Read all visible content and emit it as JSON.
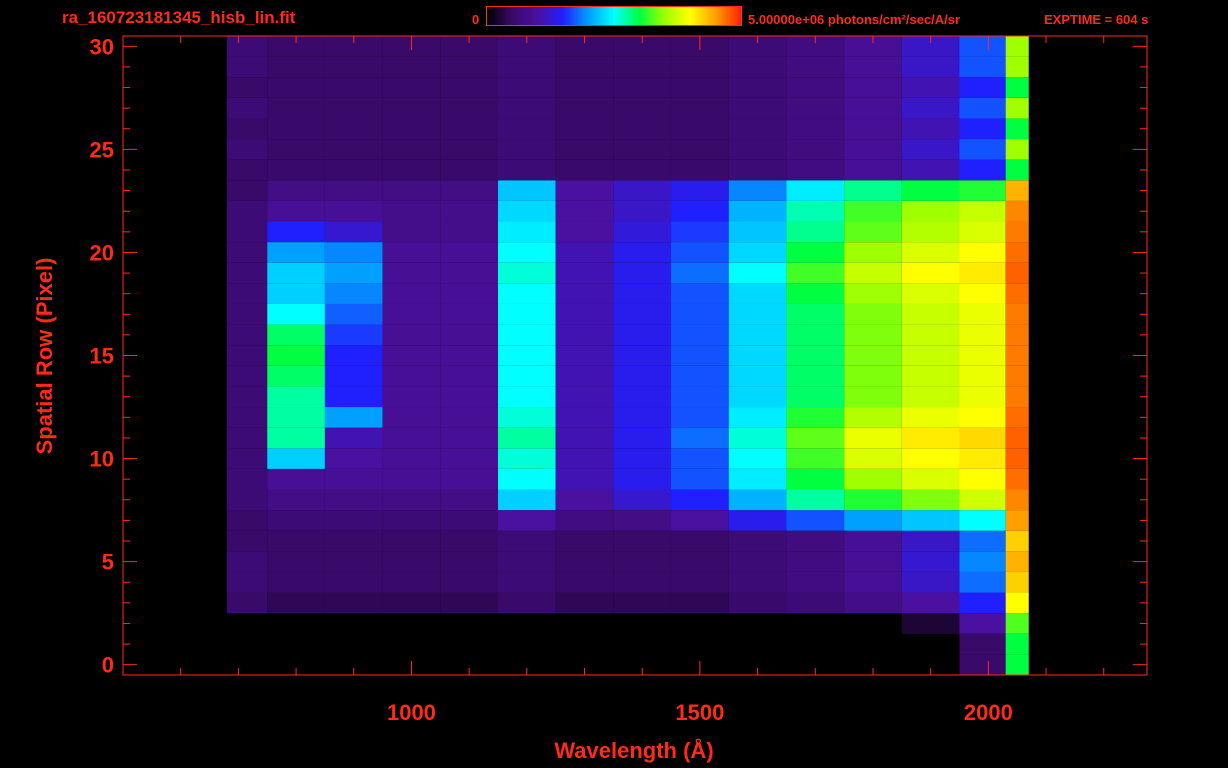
{
  "header": {
    "filename": "ra_160723181345_hisb_lin.fit",
    "colorbar_min_label": "0",
    "colorbar_max_label": "5.00000e+06 photons/cm²/sec/A/sr",
    "exptime_label": "EXPTIME = 604 s"
  },
  "colors": {
    "axis": "#ff2a1a",
    "background": "#000000",
    "colormap": [
      "#000000",
      "#3a0a6a",
      "#4a10a0",
      "#2020ff",
      "#00a0ff",
      "#00ffff",
      "#00ff40",
      "#a0ff00",
      "#ffff00",
      "#ffa000",
      "#ff2000"
    ]
  },
  "chart_data": {
    "type": "heatmap",
    "title": "ra_160723181345_hisb_lin.fit",
    "xlabel": "Wavelength (Å)",
    "ylabel": "Spatial Row (Pixel)",
    "xlim": [
      500,
      2275
    ],
    "ylim": [
      -0.5,
      30.5
    ],
    "x_ticks": [
      1000,
      1500,
      2000
    ],
    "y_ticks": [
      0,
      5,
      10,
      15,
      20,
      25,
      30
    ],
    "colorbar_range": [
      0,
      5000000
    ],
    "colorbar_units": "photons/cm²/sec/A/sr",
    "grid": false,
    "rows": [
      0,
      1,
      2,
      3,
      4,
      5,
      6,
      7,
      8,
      9,
      10,
      11,
      12,
      13,
      14,
      15,
      16,
      17,
      18,
      19,
      20,
      21,
      22,
      23,
      24,
      25,
      26,
      27,
      28,
      29,
      30
    ],
    "wavelength_samples": [
      700,
      800,
      900,
      1000,
      1100,
      1200,
      1300,
      1400,
      1500,
      1600,
      1700,
      1800,
      1900,
      2000,
      2060
    ],
    "intensity_by_row": [
      [
        0.0,
        0.0,
        0.0,
        0.0,
        0.0,
        0.0,
        0.0,
        0.0,
        0.0,
        0.0,
        0.0,
        0.0,
        0.0,
        0.1,
        0.6
      ],
      [
        0.0,
        0.0,
        0.0,
        0.0,
        0.0,
        0.0,
        0.0,
        0.0,
        0.0,
        0.0,
        0.0,
        0.0,
        0.0,
        0.1,
        0.6
      ],
      [
        0.0,
        0.0,
        0.0,
        0.0,
        0.0,
        0.0,
        0.0,
        0.0,
        0.0,
        0.0,
        0.0,
        0.0,
        0.05,
        0.2,
        0.65
      ],
      [
        0.1,
        0.08,
        0.08,
        0.08,
        0.08,
        0.1,
        0.08,
        0.08,
        0.08,
        0.1,
        0.12,
        0.15,
        0.2,
        0.3,
        0.8
      ],
      [
        0.12,
        0.1,
        0.1,
        0.1,
        0.1,
        0.12,
        0.1,
        0.1,
        0.1,
        0.12,
        0.14,
        0.18,
        0.24,
        0.36,
        0.85
      ],
      [
        0.12,
        0.1,
        0.1,
        0.1,
        0.1,
        0.12,
        0.1,
        0.1,
        0.1,
        0.12,
        0.14,
        0.18,
        0.25,
        0.38,
        0.88
      ],
      [
        0.1,
        0.1,
        0.1,
        0.1,
        0.1,
        0.12,
        0.1,
        0.1,
        0.1,
        0.12,
        0.14,
        0.18,
        0.24,
        0.36,
        0.85
      ],
      [
        0.1,
        0.12,
        0.12,
        0.12,
        0.12,
        0.2,
        0.14,
        0.15,
        0.2,
        0.28,
        0.34,
        0.4,
        0.44,
        0.5,
        0.9
      ],
      [
        0.12,
        0.15,
        0.15,
        0.15,
        0.15,
        0.45,
        0.2,
        0.25,
        0.3,
        0.42,
        0.55,
        0.62,
        0.68,
        0.75,
        0.92
      ],
      [
        0.12,
        0.18,
        0.18,
        0.18,
        0.18,
        0.5,
        0.22,
        0.28,
        0.34,
        0.48,
        0.6,
        0.7,
        0.76,
        0.8,
        0.94
      ],
      [
        0.12,
        0.45,
        0.2,
        0.18,
        0.18,
        0.52,
        0.22,
        0.28,
        0.34,
        0.5,
        0.64,
        0.76,
        0.8,
        0.82,
        0.95
      ],
      [
        0.12,
        0.55,
        0.22,
        0.18,
        0.18,
        0.55,
        0.22,
        0.28,
        0.36,
        0.52,
        0.66,
        0.78,
        0.82,
        0.84,
        0.95
      ],
      [
        0.12,
        0.55,
        0.4,
        0.18,
        0.18,
        0.52,
        0.22,
        0.28,
        0.34,
        0.48,
        0.62,
        0.72,
        0.78,
        0.8,
        0.94
      ],
      [
        0.12,
        0.55,
        0.3,
        0.18,
        0.18,
        0.5,
        0.22,
        0.28,
        0.34,
        0.46,
        0.58,
        0.68,
        0.74,
        0.78,
        0.93
      ],
      [
        0.12,
        0.58,
        0.3,
        0.18,
        0.18,
        0.5,
        0.22,
        0.28,
        0.34,
        0.46,
        0.58,
        0.68,
        0.74,
        0.78,
        0.93
      ],
      [
        0.12,
        0.6,
        0.3,
        0.18,
        0.18,
        0.5,
        0.22,
        0.28,
        0.34,
        0.46,
        0.58,
        0.68,
        0.74,
        0.78,
        0.93
      ],
      [
        0.12,
        0.58,
        0.32,
        0.18,
        0.18,
        0.5,
        0.22,
        0.28,
        0.34,
        0.46,
        0.58,
        0.68,
        0.74,
        0.78,
        0.93
      ],
      [
        0.12,
        0.5,
        0.35,
        0.18,
        0.18,
        0.5,
        0.22,
        0.28,
        0.34,
        0.46,
        0.58,
        0.68,
        0.74,
        0.78,
        0.93
      ],
      [
        0.12,
        0.45,
        0.38,
        0.18,
        0.18,
        0.5,
        0.22,
        0.28,
        0.34,
        0.46,
        0.6,
        0.7,
        0.76,
        0.8,
        0.94
      ],
      [
        0.12,
        0.45,
        0.4,
        0.18,
        0.18,
        0.52,
        0.22,
        0.28,
        0.36,
        0.5,
        0.64,
        0.74,
        0.8,
        0.82,
        0.95
      ],
      [
        0.12,
        0.4,
        0.38,
        0.18,
        0.18,
        0.5,
        0.22,
        0.28,
        0.34,
        0.46,
        0.6,
        0.7,
        0.76,
        0.8,
        0.94
      ],
      [
        0.12,
        0.3,
        0.25,
        0.16,
        0.16,
        0.48,
        0.2,
        0.26,
        0.32,
        0.44,
        0.56,
        0.66,
        0.72,
        0.76,
        0.93
      ],
      [
        0.12,
        0.18,
        0.18,
        0.16,
        0.16,
        0.46,
        0.2,
        0.24,
        0.3,
        0.42,
        0.54,
        0.64,
        0.7,
        0.74,
        0.92
      ],
      [
        0.1,
        0.15,
        0.15,
        0.15,
        0.15,
        0.44,
        0.2,
        0.24,
        0.28,
        0.38,
        0.48,
        0.56,
        0.6,
        0.62,
        0.88
      ],
      [
        0.1,
        0.1,
        0.1,
        0.1,
        0.1,
        0.12,
        0.1,
        0.1,
        0.1,
        0.12,
        0.14,
        0.18,
        0.22,
        0.3,
        0.6
      ],
      [
        0.12,
        0.1,
        0.1,
        0.1,
        0.1,
        0.12,
        0.1,
        0.1,
        0.1,
        0.12,
        0.14,
        0.18,
        0.24,
        0.34,
        0.7
      ],
      [
        0.1,
        0.1,
        0.1,
        0.1,
        0.1,
        0.12,
        0.1,
        0.1,
        0.1,
        0.12,
        0.14,
        0.18,
        0.22,
        0.3,
        0.6
      ],
      [
        0.12,
        0.1,
        0.1,
        0.1,
        0.1,
        0.12,
        0.1,
        0.1,
        0.1,
        0.12,
        0.14,
        0.18,
        0.24,
        0.34,
        0.7
      ],
      [
        0.1,
        0.1,
        0.1,
        0.1,
        0.1,
        0.12,
        0.1,
        0.1,
        0.1,
        0.12,
        0.14,
        0.18,
        0.22,
        0.3,
        0.6
      ],
      [
        0.12,
        0.1,
        0.1,
        0.1,
        0.1,
        0.12,
        0.1,
        0.1,
        0.1,
        0.12,
        0.14,
        0.18,
        0.24,
        0.34,
        0.7
      ],
      [
        0.12,
        0.1,
        0.1,
        0.1,
        0.1,
        0.12,
        0.1,
        0.1,
        0.1,
        0.12,
        0.14,
        0.18,
        0.24,
        0.34,
        0.7
      ]
    ]
  }
}
